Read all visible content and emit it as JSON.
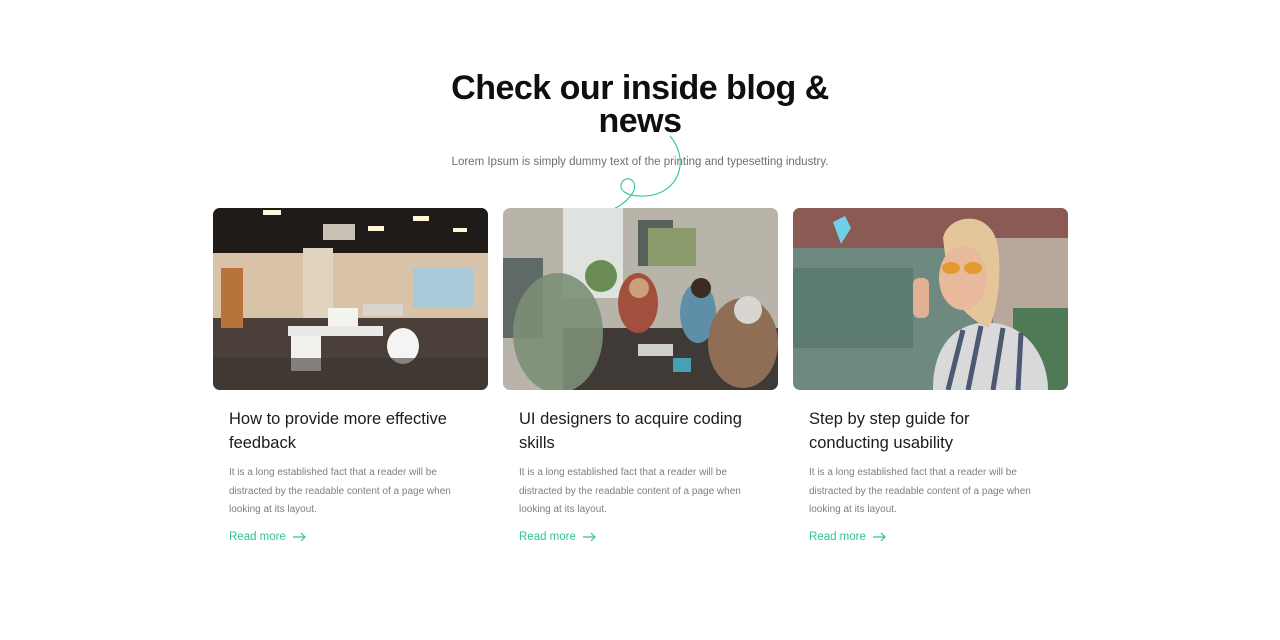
{
  "section": {
    "title": "Check our inside blog & news",
    "subtitle": "Lorem Ipsum is simply dummy text of the printing and typesetting industry."
  },
  "colors": {
    "accent": "#2ec49b",
    "heading": "#0f0f0f",
    "body_text": "#7a7f86"
  },
  "posts": [
    {
      "image_alt": "open office interior",
      "title": "How to provide more effective feedback",
      "excerpt": "It is a long established fact that a reader will be distracted by the readable content of a page when looking at its layout.",
      "link_label": "Read more",
      "link_icon": "arrow-right-icon"
    },
    {
      "image_alt": "team meeting at a table",
      "title": "UI designers to acquire coding skills",
      "excerpt": "It is a long established fact that a reader will be distracted by the readable content of a page when looking at its layout.",
      "link_label": "Read more",
      "link_icon": "arrow-right-icon"
    },
    {
      "image_alt": "woman with sunglasses",
      "title": "Step by step guide for conducting usability",
      "excerpt": "It is a long established fact that a reader will be distracted by the readable content of a page when looking at its layout.",
      "link_label": "Read more",
      "link_icon": "arrow-right-icon"
    }
  ]
}
